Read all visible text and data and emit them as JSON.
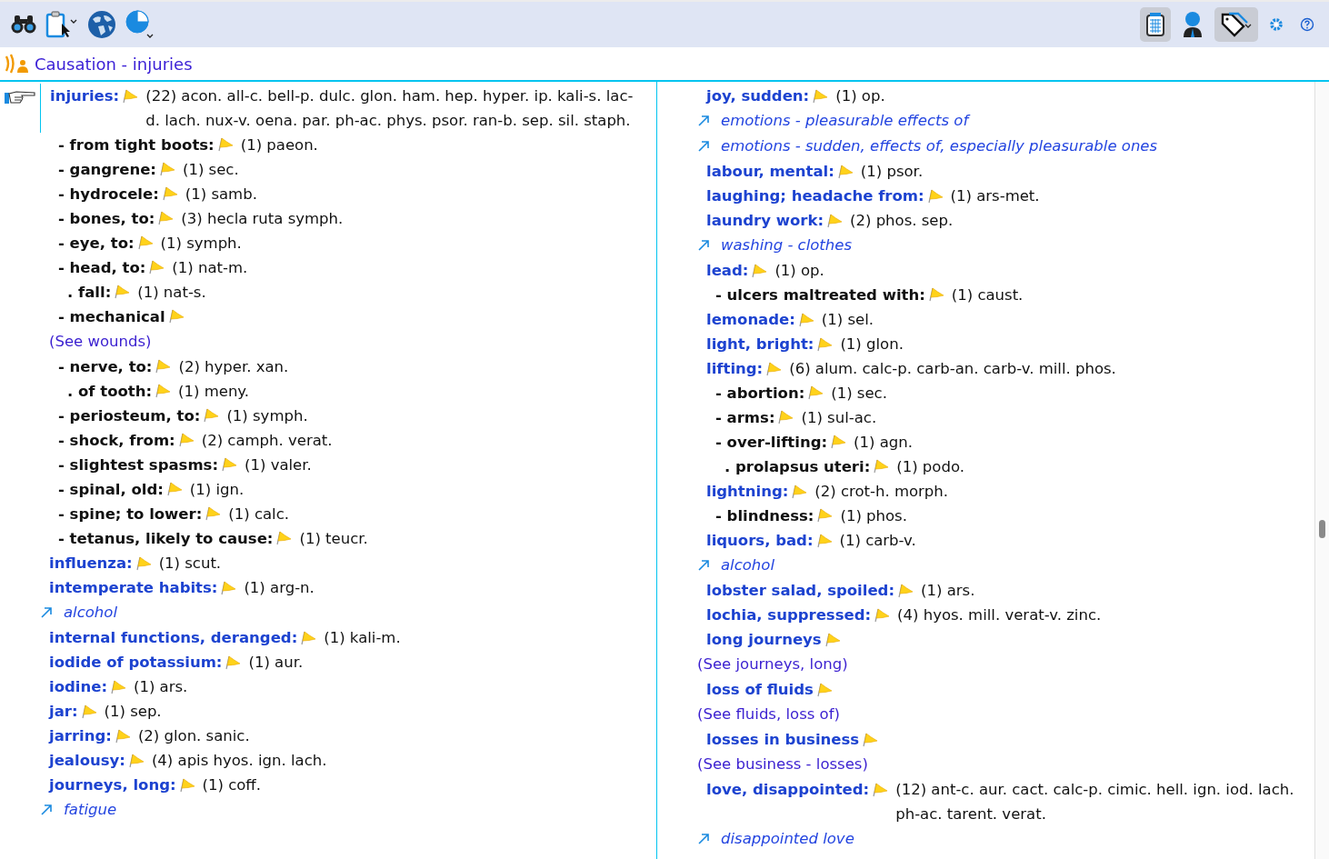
{
  "toolbar": {
    "right_buttons": [
      {
        "on": true
      },
      {
        "on": false
      },
      {
        "on": true
      },
      {
        "on": false
      },
      {
        "on": false
      }
    ]
  },
  "header": {
    "title": "Causation - injuries"
  },
  "columns": [
    {
      "entries": [
        {
          "kind": "rubric",
          "selected": true,
          "label": "injuries:",
          "count": "(22)",
          "remedies": "acon. all-c. bell-p. dulc. glon. ham. hep. hyper. ip. kali-s. lac-d. lach. nux-v. oena. par. ph-ac. phys. psor. ran-b. sep. sil. staph.",
          "children": [
            {
              "kind": "sub",
              "label": "- from tight boots:",
              "count": "(1)",
              "remedies": "paeon."
            },
            {
              "kind": "sub",
              "label": "- gangrene:",
              "count": "(1)",
              "remedies": "sec."
            },
            {
              "kind": "sub",
              "label": "- hydrocele:",
              "count": "(1)",
              "remedies": "samb."
            },
            {
              "kind": "sub",
              "label": "- bones, to:",
              "count": "(3)",
              "remedies": "hecla ruta symph."
            },
            {
              "kind": "sub",
              "label": "- eye, to:",
              "count": "(1)",
              "remedies": "symph."
            },
            {
              "kind": "sub",
              "label": "- head, to:",
              "count": "(1)",
              "remedies": "nat-m.",
              "children": [
                {
                  "kind": "sub",
                  "label": ". fall:",
                  "count": "(1)",
                  "remedies": "nat-s."
                }
              ]
            },
            {
              "kind": "sub",
              "label": "- mechanical"
            },
            {
              "kind": "see",
              "label": "(See wounds)"
            },
            {
              "kind": "sub",
              "label": "- nerve, to:",
              "count": "(2)",
              "remedies": "hyper. xan.",
              "children": [
                {
                  "kind": "sub",
                  "label": ". of tooth:",
                  "count": "(1)",
                  "remedies": "meny."
                }
              ]
            },
            {
              "kind": "sub",
              "label": "- periosteum, to:",
              "count": "(1)",
              "remedies": "symph."
            },
            {
              "kind": "sub",
              "label": "- shock, from:",
              "count": "(2)",
              "remedies": "camph. verat."
            },
            {
              "kind": "sub",
              "label": "- slightest spasms:",
              "count": "(1)",
              "remedies": "valer."
            },
            {
              "kind": "sub",
              "label": "- spinal, old:",
              "count": "(1)",
              "remedies": "ign."
            },
            {
              "kind": "sub",
              "label": "- spine; to lower:",
              "count": "(1)",
              "remedies": "calc."
            },
            {
              "kind": "sub",
              "label": "- tetanus, likely to cause:",
              "count": "(1)",
              "remedies": "teucr."
            }
          ]
        },
        {
          "kind": "rubric",
          "selected": false,
          "label": "influenza:",
          "count": "(1)",
          "remedies": "scut."
        },
        {
          "kind": "rubric",
          "selected": false,
          "label": "intemperate habits:",
          "count": "(1)",
          "remedies": "arg-n."
        },
        {
          "kind": "xref",
          "label": "alcohol"
        },
        {
          "kind": "rubric",
          "selected": false,
          "label": "internal functions, deranged:",
          "count": "(1)",
          "remedies": "kali-m."
        },
        {
          "kind": "rubric",
          "selected": false,
          "label": "iodide of potassium:",
          "count": "(1)",
          "remedies": "aur."
        },
        {
          "kind": "rubric",
          "selected": false,
          "label": "iodine:",
          "count": "(1)",
          "remedies": "ars."
        },
        {
          "kind": "rubric",
          "selected": false,
          "label": "jar:",
          "count": "(1)",
          "remedies": "sep."
        },
        {
          "kind": "rubric",
          "selected": false,
          "label": "jarring:",
          "count": "(2)",
          "remedies": "glon. sanic."
        },
        {
          "kind": "rubric",
          "selected": false,
          "label": "jealousy:",
          "count": "(4)",
          "remedies": "apis hyos. ign. lach."
        },
        {
          "kind": "rubric",
          "selected": false,
          "label": "journeys, long:",
          "count": "(1)",
          "remedies": "coff."
        },
        {
          "kind": "xref",
          "label": "fatigue"
        }
      ]
    },
    {
      "entries": [
        {
          "kind": "rubric",
          "selected": false,
          "label": "joy, sudden:",
          "count": "(1)",
          "remedies": "op."
        },
        {
          "kind": "xref",
          "label": "emotions - pleasurable effects of"
        },
        {
          "kind": "xref",
          "label": "emotions - sudden, effects of, especially pleasurable ones"
        },
        {
          "kind": "rubric",
          "selected": false,
          "label": "labour, mental:",
          "count": "(1)",
          "remedies": "psor."
        },
        {
          "kind": "rubric",
          "selected": false,
          "label": "laughing; headache from:",
          "count": "(1)",
          "remedies": "ars-met."
        },
        {
          "kind": "rubric",
          "selected": false,
          "label": "laundry work:",
          "count": "(2)",
          "remedies": "phos. sep."
        },
        {
          "kind": "xref",
          "label": "washing - clothes"
        },
        {
          "kind": "rubric",
          "selected": false,
          "label": "lead:",
          "count": "(1)",
          "remedies": "op.",
          "children": [
            {
              "kind": "sub",
              "label": "- ulcers maltreated with:",
              "count": "(1)",
              "remedies": "caust."
            }
          ]
        },
        {
          "kind": "rubric",
          "selected": false,
          "label": "lemonade:",
          "count": "(1)",
          "remedies": "sel."
        },
        {
          "kind": "rubric",
          "selected": false,
          "label": "light, bright:",
          "count": "(1)",
          "remedies": "glon."
        },
        {
          "kind": "rubric",
          "selected": false,
          "label": "lifting:",
          "count": "(6)",
          "remedies": "alum. calc-p. carb-an. carb-v. mill. phos.",
          "children": [
            {
              "kind": "sub",
              "label": "- abortion:",
              "count": "(1)",
              "remedies": "sec."
            },
            {
              "kind": "sub",
              "label": "- arms:",
              "count": "(1)",
              "remedies": "sul-ac."
            },
            {
              "kind": "sub",
              "label": "- over-lifting:",
              "count": "(1)",
              "remedies": "agn.",
              "children": [
                {
                  "kind": "sub",
                  "label": ". prolapsus uteri:",
                  "count": "(1)",
                  "remedies": "podo."
                }
              ]
            }
          ]
        },
        {
          "kind": "rubric",
          "selected": false,
          "label": "lightning:",
          "count": "(2)",
          "remedies": "crot-h. morph.",
          "children": [
            {
              "kind": "sub",
              "label": "- blindness:",
              "count": "(1)",
              "remedies": "phos."
            }
          ]
        },
        {
          "kind": "rubric",
          "selected": false,
          "label": "liquors, bad:",
          "count": "(1)",
          "remedies": "carb-v."
        },
        {
          "kind": "xref",
          "label": "alcohol"
        },
        {
          "kind": "rubric",
          "selected": false,
          "label": "lobster salad, spoiled:",
          "count": "(1)",
          "remedies": "ars."
        },
        {
          "kind": "rubric",
          "selected": false,
          "label": "lochia, suppressed:",
          "count": "(4)",
          "remedies": "hyos. mill. verat-v. zinc."
        },
        {
          "kind": "rubric",
          "selected": false,
          "label": "long journeys"
        },
        {
          "kind": "see",
          "label": "(See journeys, long)"
        },
        {
          "kind": "rubric",
          "selected": false,
          "label": "loss of fluids"
        },
        {
          "kind": "see",
          "label": "(See fluids, loss of)"
        },
        {
          "kind": "rubric",
          "selected": false,
          "label": "losses in business"
        },
        {
          "kind": "see",
          "label": "(See business - losses)"
        },
        {
          "kind": "rubric",
          "selected": false,
          "label": "love, disappointed:",
          "count": "(12)",
          "remedies": "ant-c. aur. cact. calc-p. cimic. hell. ign. iod. lach. ph-ac. tarent. verat."
        },
        {
          "kind": "xref",
          "label": "disappointed love"
        }
      ]
    }
  ]
}
